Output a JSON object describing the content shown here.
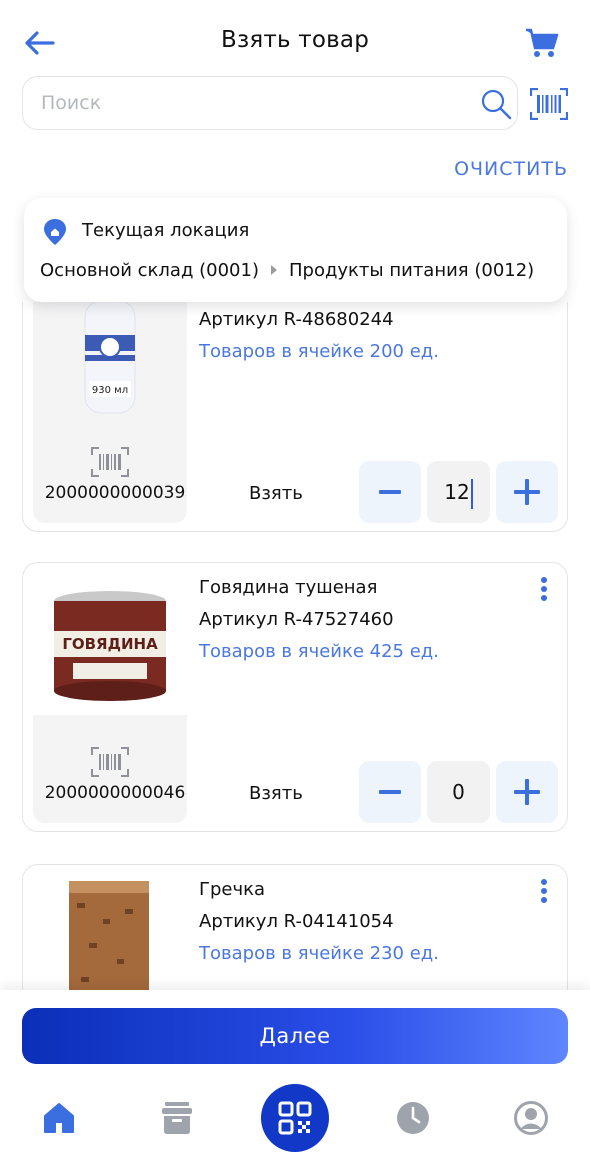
{
  "header": {
    "title": "Взять товар"
  },
  "search": {
    "placeholder": "Поиск",
    "value": ""
  },
  "clear_label": "ОЧИСТИТЬ",
  "location": {
    "title": "Текущая локация",
    "warehouse": "Основной склад (0001)",
    "zone": "Продукты питания (0012)"
  },
  "products": [
    {
      "name": "",
      "sku": "Артикул R-48680244",
      "stock": "Товаров в ячейке 200 ед.",
      "barcode": "2000000000039",
      "take_label": "Взять",
      "qty": "12",
      "image_label": "930 мл"
    },
    {
      "name": "Говядина тушеная",
      "sku": "Артикул R-47527460",
      "stock": "Товаров в ячейке 425 ед.",
      "barcode": "2000000000046",
      "take_label": "Взять",
      "qty": "0",
      "image_label": "ГОВЯДИНА"
    },
    {
      "name": "Гречка",
      "sku": "Артикул R-04141054",
      "stock": "Товаров в ячейке 230 ед."
    }
  ],
  "next_label": "Далее",
  "colors": {
    "accent": "#4a78e0",
    "primary_blue": "#1238c8",
    "icon_gray": "#9fa3ab"
  },
  "icons": [
    "back-arrow-icon",
    "cart-icon",
    "search-icon",
    "barcode-icon",
    "location-pin-icon",
    "more-vertical-icon",
    "home-icon",
    "archive-icon",
    "qr-code-icon",
    "clock-icon",
    "user-icon"
  ]
}
